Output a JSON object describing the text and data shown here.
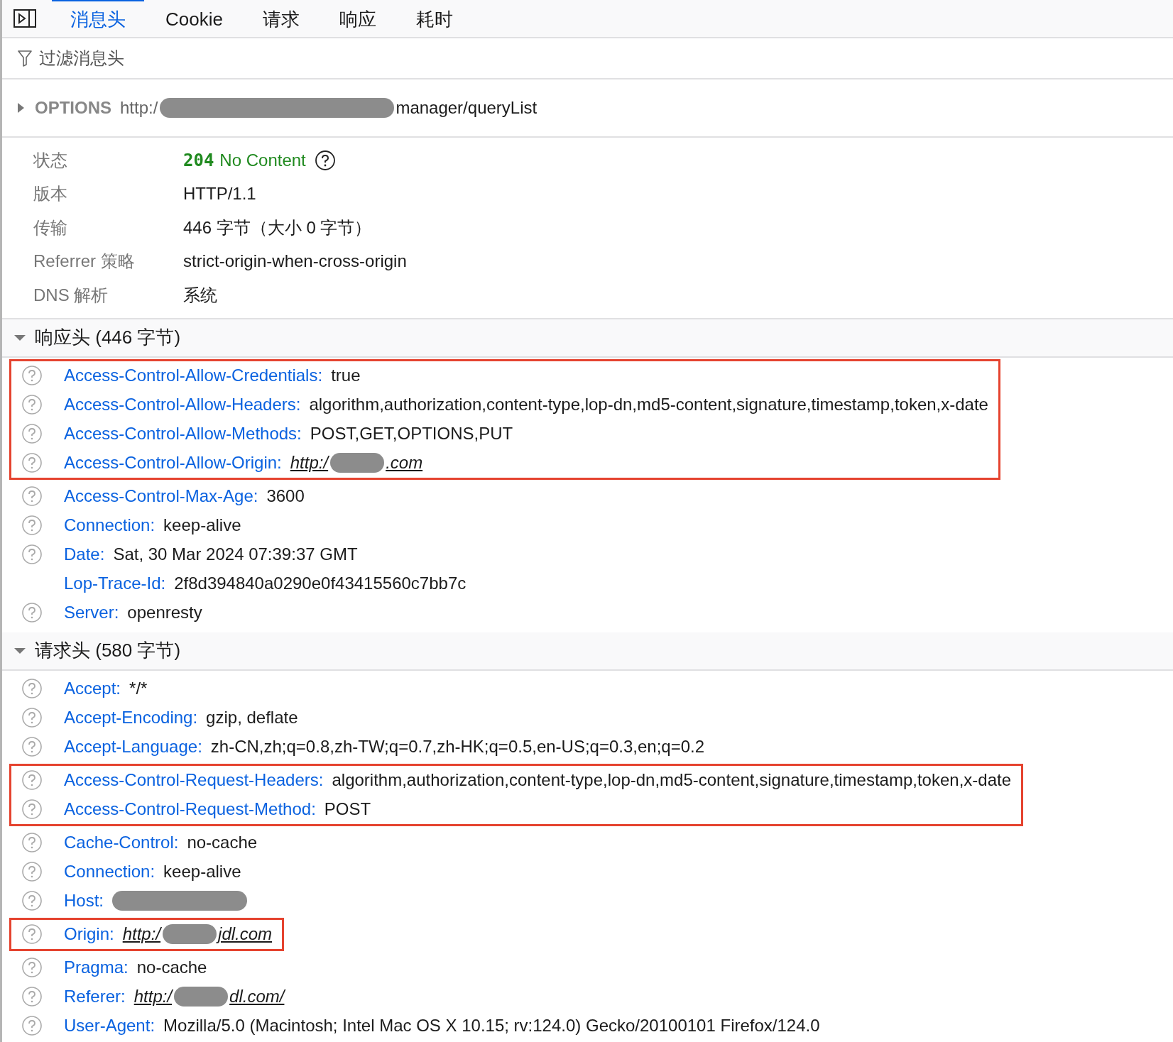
{
  "tabs": [
    {
      "label": "消息头",
      "selected": true
    },
    {
      "label": "Cookie",
      "selected": false
    },
    {
      "label": "请求",
      "selected": false
    },
    {
      "label": "响应",
      "selected": false
    },
    {
      "label": "耗时",
      "selected": false
    }
  ],
  "filter": {
    "placeholder": "过滤消息头"
  },
  "request": {
    "expanded": false,
    "method": "OPTIONS",
    "url": "http:/",
    "url_after": "manager/queryList",
    "redacted": true
  },
  "summary": [
    {
      "label": "状态",
      "code": "204",
      "value": "No Content",
      "kind": "status"
    },
    {
      "label": "版本",
      "value": "HTTP/1.1",
      "kind": "text"
    },
    {
      "label": "传输",
      "value": "446 字节（大小 0 字节）",
      "kind": "text"
    },
    {
      "label": "Referrer 策略",
      "value": "strict-origin-when-cross-origin",
      "kind": "text"
    },
    {
      "label": "DNS 解析",
      "value": "系统",
      "kind": "text"
    }
  ],
  "sections": [
    {
      "title": "响应头 (446 字节)",
      "expanded": true,
      "groups": [
        {
          "highlighted": true,
          "rows": [
            {
              "name": "Access-Control-Allow-Credentials:",
              "value": "true",
              "help": true
            },
            {
              "name": "Access-Control-Allow-Headers:",
              "value": "algorithm,authorization,content-type,lop-dn,md5-content,signature,timestamp,token,x-date",
              "help": true
            },
            {
              "name": "Access-Control-Allow-Methods:",
              "value": "POST,GET,OPTIONS,PUT",
              "help": true
            },
            {
              "name": "Access-Control-Allow-Origin:",
              "value": "http:/",
              "value_after": ".com",
              "help": true,
              "link": true,
              "redacted": true
            }
          ]
        },
        {
          "highlighted": false,
          "rows": [
            {
              "name": "Access-Control-Max-Age:",
              "value": "3600",
              "help": true
            },
            {
              "name": "Connection:",
              "value": "keep-alive",
              "help": true
            },
            {
              "name": "Date:",
              "value": "Sat, 30 Mar 2024 07:39:37 GMT",
              "help": true
            },
            {
              "name": "Lop-Trace-Id:",
              "value": "2f8d394840a0290e0f43415560c7bb7c",
              "help": false
            },
            {
              "name": "Server:",
              "value": "openresty",
              "help": true
            }
          ]
        }
      ]
    },
    {
      "title": "请求头 (580 字节)",
      "expanded": true,
      "groups": [
        {
          "highlighted": false,
          "rows": [
            {
              "name": "Accept:",
              "value": "*/*",
              "help": true
            },
            {
              "name": "Accept-Encoding:",
              "value": "gzip, deflate",
              "help": true
            },
            {
              "name": "Accept-Language:",
              "value": "zh-CN,zh;q=0.8,zh-TW;q=0.7,zh-HK;q=0.5,en-US;q=0.3,en;q=0.2",
              "help": true
            }
          ]
        },
        {
          "highlighted": true,
          "rows": [
            {
              "name": "Access-Control-Request-Headers:",
              "value": "algorithm,authorization,content-type,lop-dn,md5-content,signature,timestamp,token,x-date",
              "help": true
            },
            {
              "name": "Access-Control-Request-Method:",
              "value": "POST",
              "help": true
            }
          ]
        },
        {
          "highlighted": false,
          "rows": [
            {
              "name": "Cache-Control:",
              "value": "no-cache",
              "help": true
            },
            {
              "name": "Connection:",
              "value": "keep-alive",
              "help": true
            },
            {
              "name": "Host:",
              "help": true,
              "redacted": true
            }
          ]
        },
        {
          "highlighted": true,
          "rows": [
            {
              "name": "Origin:",
              "value": "http:/",
              "value_after": "jdl.com",
              "help": true,
              "link": true,
              "redacted": true
            }
          ]
        },
        {
          "highlighted": false,
          "rows": [
            {
              "name": "Pragma:",
              "value": "no-cache",
              "help": true
            },
            {
              "name": "Referer:",
              "value": "http:/",
              "value_after": "dl.com/",
              "help": true,
              "link": true,
              "redacted": true
            },
            {
              "name": "User-Agent:",
              "value": "Mozilla/5.0 (Macintosh; Intel Mac OS X 10.15; rv:124.0) Gecko/20100101 Firefox/124.0",
              "help": true
            }
          ]
        }
      ]
    }
  ]
}
